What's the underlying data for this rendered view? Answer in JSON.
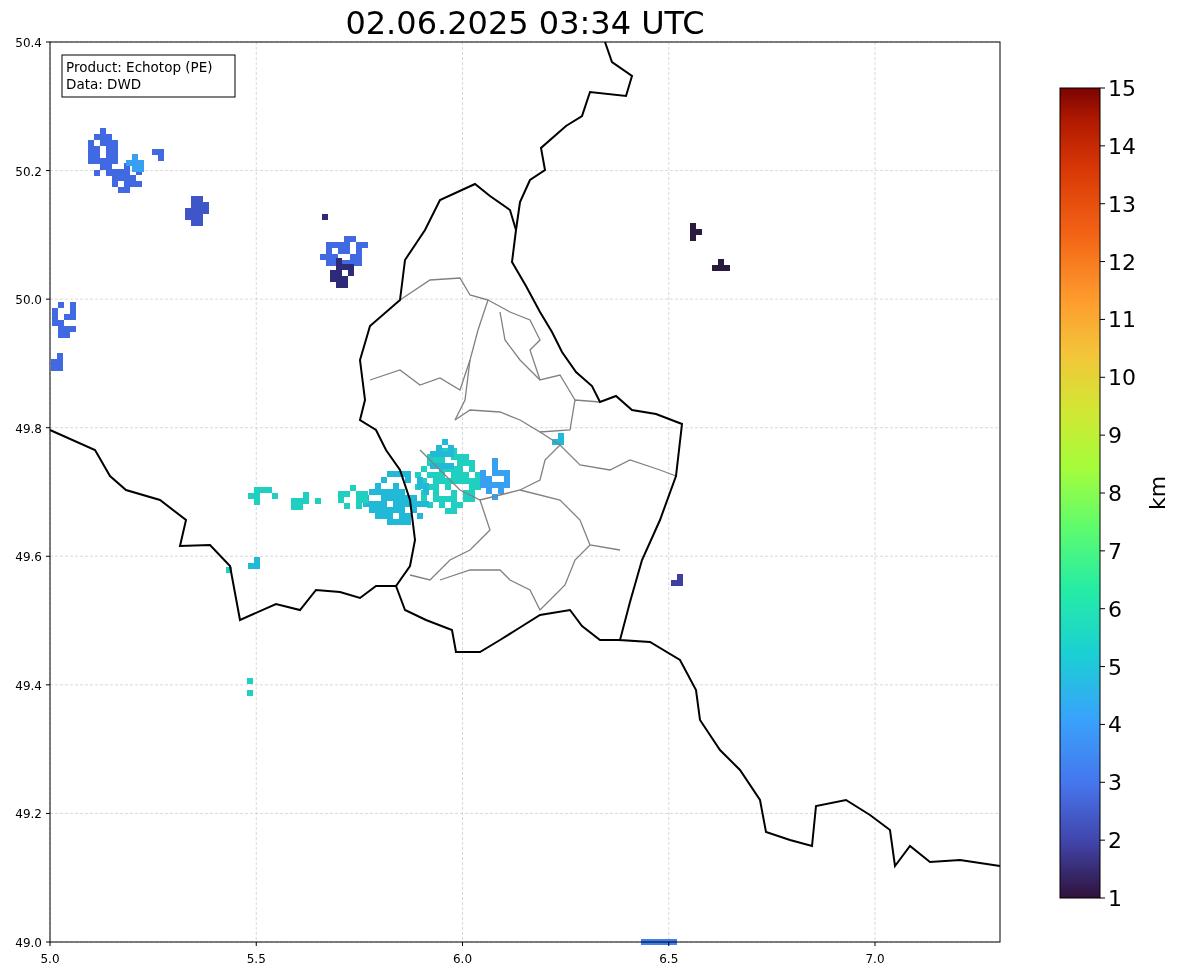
{
  "title": "02.06.2025 03:34 UTC",
  "info_box": {
    "lines": [
      "Product: Echotop (PE)",
      "Data: DWD"
    ]
  },
  "map": {
    "x_ticks": [
      "5.0",
      "5.5",
      "6.0",
      "6.5",
      "7.0"
    ],
    "y_ticks": [
      "50.4",
      "50.2",
      "50.0",
      "49.8",
      "49.6",
      "49.4",
      "49.2",
      "49.0"
    ]
  },
  "colorbar": {
    "label": "km",
    "ticks": [
      "15",
      "14",
      "13",
      "12",
      "11",
      "10",
      "9",
      "8",
      "7",
      "6",
      "5",
      "4",
      "3",
      "2",
      "1"
    ]
  }
}
